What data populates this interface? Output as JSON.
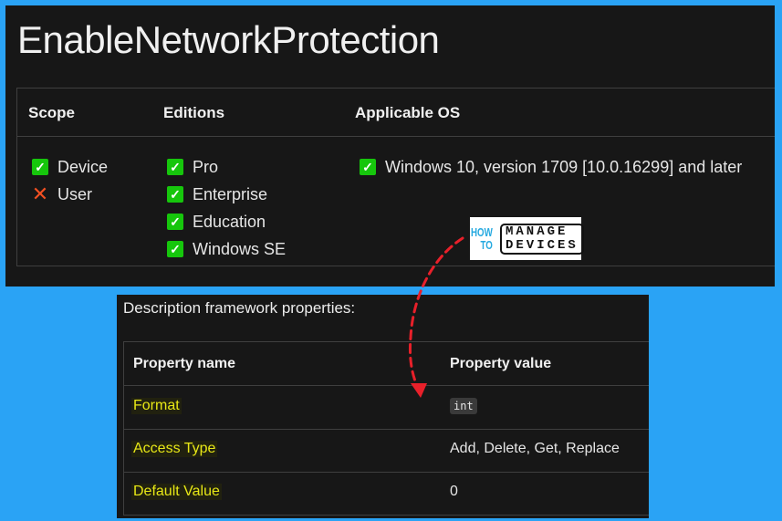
{
  "title": "EnableNetworkProtection",
  "applicability": {
    "headers": {
      "scope": "Scope",
      "editions": "Editions",
      "os": "Applicable OS"
    },
    "scope": [
      {
        "label": "Device",
        "status": "check-icon"
      },
      {
        "label": "User",
        "status": "cross-icon"
      }
    ],
    "editions": [
      {
        "label": "Pro",
        "status": "check-icon"
      },
      {
        "label": "Enterprise",
        "status": "check-icon"
      },
      {
        "label": "Education",
        "status": "check-icon"
      },
      {
        "label": "Windows SE",
        "status": "check-icon"
      }
    ],
    "os": [
      {
        "label": "Windows 10, version 1709 [10.0.16299] and later",
        "status": "check-icon"
      }
    ]
  },
  "logo": {
    "how": "HOW",
    "to": "TO",
    "manage": "MANAGE",
    "devices": "DEVICES"
  },
  "description": {
    "title": "Description framework properties:",
    "headers": {
      "name": "Property name",
      "value": "Property value"
    },
    "rows": [
      {
        "name": "Format",
        "value": "int",
        "is_code": true
      },
      {
        "name": "Access Type",
        "value": "Add, Delete, Get, Replace",
        "is_code": false
      },
      {
        "name": "Default Value",
        "value": "0",
        "is_code": false
      }
    ]
  },
  "colors": {
    "background": "#2aa3f5",
    "panel": "#171717",
    "check": "#16c60c",
    "cross": "#f25022",
    "property_name": "#e8e816",
    "arrow": "#e8202a"
  },
  "glyphs": {
    "check": "✓",
    "cross": "✕"
  }
}
